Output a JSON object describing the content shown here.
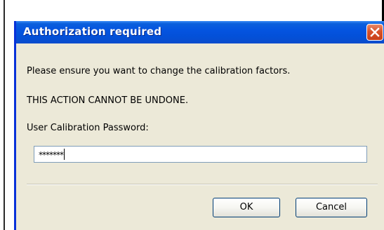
{
  "dialog": {
    "title": "Authorization required",
    "message": "Please ensure you want to change the calibration factors.",
    "warning": "THIS ACTION CANNOT BE UNDONE.",
    "password_label": "User Calibration Password:",
    "password_value": "*******",
    "ok_label": "OK",
    "cancel_label": "Cancel"
  },
  "icons": {
    "close": "close-icon"
  },
  "colors": {
    "titlebar": "#0454e0",
    "close_button": "#d8522a",
    "dialog_background": "#ece9d8"
  }
}
